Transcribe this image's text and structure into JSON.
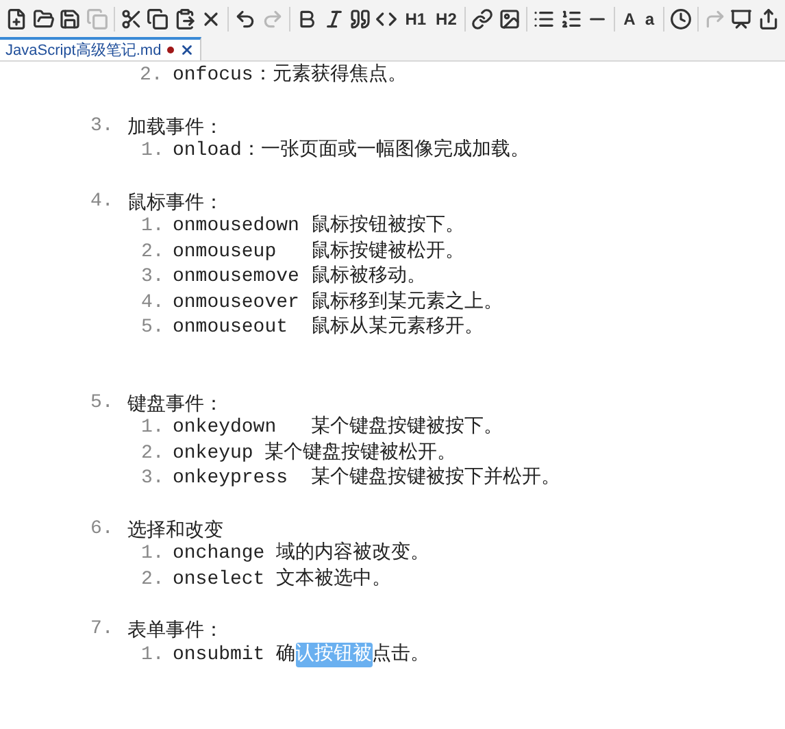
{
  "toolbar": [
    {
      "kind": "icon",
      "disabled": false
    },
    {
      "kind": "icon",
      "disabled": false
    },
    {
      "kind": "icon",
      "disabled": false
    },
    {
      "kind": "icon",
      "disabled": true
    },
    {
      "kind": "sep"
    },
    {
      "kind": "icon",
      "disabled": false
    },
    {
      "kind": "icon",
      "disabled": false
    },
    {
      "kind": "icon",
      "disabled": false
    },
    {
      "kind": "icon",
      "disabled": false
    },
    {
      "kind": "sep"
    },
    {
      "kind": "icon",
      "disabled": false
    },
    {
      "kind": "icon",
      "disabled": true
    },
    {
      "kind": "sep"
    },
    {
      "kind": "icon",
      "disabled": false
    },
    {
      "kind": "icon",
      "disabled": false
    },
    {
      "kind": "icon",
      "disabled": false
    },
    {
      "kind": "icon",
      "disabled": false
    },
    {
      "kind": "text",
      "label": "H1",
      "disabled": false
    },
    {
      "kind": "text",
      "label": "H2",
      "disabled": false
    },
    {
      "kind": "sep"
    },
    {
      "kind": "icon",
      "disabled": false
    },
    {
      "kind": "icon",
      "disabled": false
    },
    {
      "kind": "sep"
    },
    {
      "kind": "icon",
      "disabled": false
    },
    {
      "kind": "icon",
      "disabled": false
    },
    {
      "kind": "icon",
      "disabled": false
    },
    {
      "kind": "sep"
    },
    {
      "kind": "text",
      "label": "A",
      "disabled": false
    },
    {
      "kind": "text",
      "label": "a",
      "disabled": false
    },
    {
      "kind": "sep"
    },
    {
      "kind": "icon",
      "disabled": false
    },
    {
      "kind": "sep"
    },
    {
      "kind": "icon",
      "disabled": true
    },
    {
      "kind": "icon",
      "disabled": false
    },
    {
      "kind": "icon",
      "disabled": false
    }
  ],
  "tabs": [
    {
      "title": "JavaScript高级笔记.md",
      "modified": true,
      "selected": true
    }
  ],
  "document": {
    "partial_item": {
      "number": "2.",
      "text": "onfocus：元素获得焦点。"
    },
    "sections": [
      {
        "number": "3.",
        "heading": "加载事件：",
        "items": [
          {
            "number": "1.",
            "parts": [
              {
                "text": "onload：一张页面或一幅图像完成加载。",
                "selected": false
              }
            ]
          }
        ]
      },
      {
        "number": "4.",
        "heading": "鼠标事件：",
        "items": [
          {
            "number": "1.",
            "parts": [
              {
                "text": "onmousedown 鼠标按钮被按下。",
                "selected": false
              }
            ]
          },
          {
            "number": "2.",
            "parts": [
              {
                "text": "onmouseup   鼠标按键被松开。",
                "selected": false
              }
            ]
          },
          {
            "number": "3.",
            "parts": [
              {
                "text": "onmousemove 鼠标被移动。",
                "selected": false
              }
            ]
          },
          {
            "number": "4.",
            "parts": [
              {
                "text": "onmouseover 鼠标移到某元素之上。",
                "selected": false
              }
            ]
          },
          {
            "number": "5.",
            "parts": [
              {
                "text": "onmouseout  鼠标从某元素移开。",
                "selected": false
              }
            ]
          }
        ]
      },
      {
        "number": "5.",
        "heading": "键盘事件：",
        "items": [
          {
            "number": "1.",
            "parts": [
              {
                "text": "onkeydown   某个键盘按键被按下。",
                "selected": false
              }
            ]
          },
          {
            "number": "2.",
            "parts": [
              {
                "text": "onkeyup 某个键盘按键被松开。",
                "selected": false
              }
            ]
          },
          {
            "number": "3.",
            "parts": [
              {
                "text": "onkeypress  某个键盘按键被按下并松开。",
                "selected": false
              }
            ]
          }
        ]
      },
      {
        "number": "6.",
        "heading": "选择和改变",
        "items": [
          {
            "number": "1.",
            "parts": [
              {
                "text": "onchange 域的内容被改变。",
                "selected": false
              }
            ]
          },
          {
            "number": "2.",
            "parts": [
              {
                "text": "onselect 文本被选中。",
                "selected": false
              }
            ]
          }
        ]
      },
      {
        "number": "7.",
        "heading": "表单事件：",
        "items": [
          {
            "number": "1.",
            "parts": [
              {
                "text": "onsubmit 确",
                "selected": false
              },
              {
                "text": "认按钮被",
                "selected": true
              },
              {
                "text": "点击。",
                "selected": false
              }
            ]
          }
        ]
      }
    ]
  }
}
